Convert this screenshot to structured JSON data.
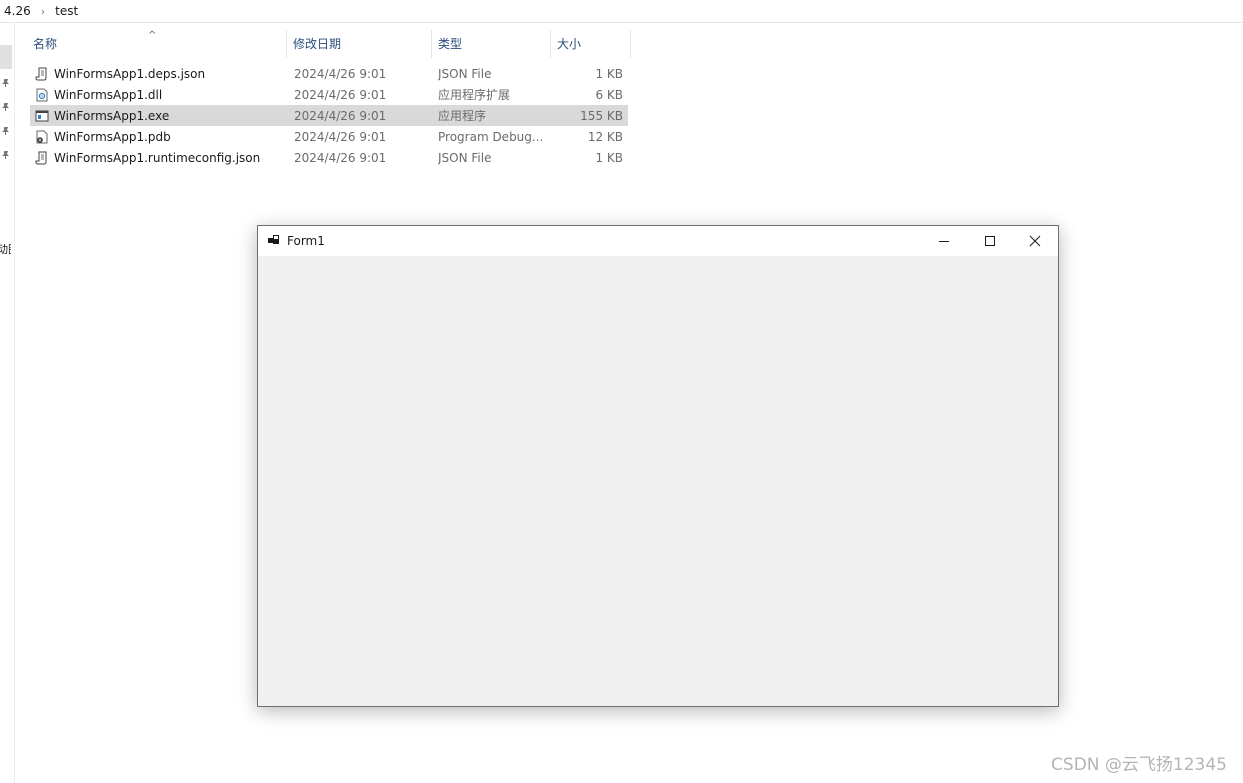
{
  "address_bar": {
    "crumbs": [
      "4.26",
      "test"
    ],
    "separator": "›"
  },
  "nav": {
    "partial_label": "动图"
  },
  "columns": {
    "name": "名称",
    "date": "修改日期",
    "type": "类型",
    "size": "大小",
    "sort_arrow": "^"
  },
  "files": [
    {
      "name": "WinFormsApp1.deps.json",
      "date": "2024/4/26 9:01",
      "type": "JSON File",
      "size": "1 KB",
      "icon": "json-file-icon",
      "selected": false
    },
    {
      "name": "WinFormsApp1.dll",
      "date": "2024/4/26 9:01",
      "type": "应用程序扩展",
      "size": "6 KB",
      "icon": "dll-file-icon",
      "selected": false
    },
    {
      "name": "WinFormsApp1.exe",
      "date": "2024/4/26 9:01",
      "type": "应用程序",
      "size": "155 KB",
      "icon": "exe-file-icon",
      "selected": true
    },
    {
      "name": "WinFormsApp1.pdb",
      "date": "2024/4/26 9:01",
      "type": "Program Debug...",
      "size": "12 KB",
      "icon": "pdb-file-icon",
      "selected": false
    },
    {
      "name": "WinFormsApp1.runtimeconfig.json",
      "date": "2024/4/26 9:01",
      "type": "JSON File",
      "size": "1 KB",
      "icon": "json-file-icon",
      "selected": false
    }
  ],
  "form_window": {
    "title": "Form1"
  },
  "watermark": "CSDN @云飞扬12345",
  "colors": {
    "selection": "#d9d9d9",
    "header_text": "#2a4d7a",
    "form_client": "#f0f0f0"
  }
}
